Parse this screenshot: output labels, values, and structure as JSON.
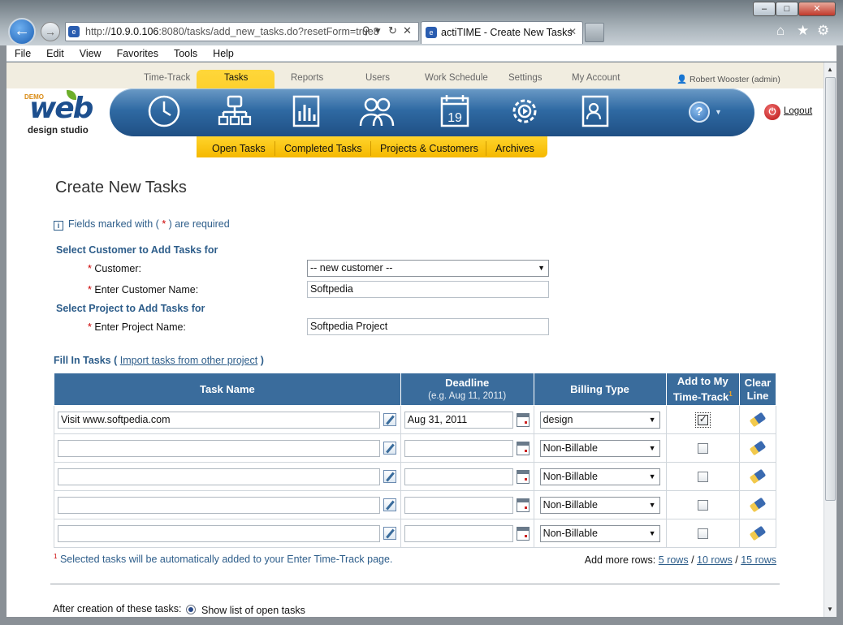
{
  "browser": {
    "url_prefix": "http://",
    "url_host": "10.9.0.106",
    "url_rest": ":8080/tasks/add_new_tasks.do?resetForm=true8",
    "tab_title": "actiTIME - Create New Tasks",
    "menu": [
      "File",
      "Edit",
      "View",
      "Favorites",
      "Tools",
      "Help"
    ],
    "win_buttons": [
      "–",
      "□",
      "✕"
    ]
  },
  "app": {
    "top_links": [
      "Time-Track",
      "Tasks",
      "Reports",
      "Users",
      "Work Schedule",
      "Settings",
      "My Account"
    ],
    "user": "Robert Wooster (admin)",
    "logo_demo": "DEMO",
    "logo_web": "web",
    "logo_sub": "design studio",
    "sub_nav": [
      "Open Tasks",
      "Completed Tasks",
      "Projects & Customers",
      "Archives"
    ],
    "logout": "Logout",
    "help": "?"
  },
  "page": {
    "title": "Create New Tasks",
    "required_note_a": "Fields marked with ( ",
    "required_star": "*",
    "required_note_b": " ) are required",
    "section_customer": "Select Customer to Add Tasks for",
    "customer_label": "Customer:",
    "customer_value": "-- new customer --",
    "customer_name_label": "Enter Customer Name:",
    "customer_name_value": "Softpedia",
    "section_project": "Select Project to Add Tasks for",
    "project_label": "Enter Project Name:",
    "project_value": "Softpedia Project",
    "fill_title": "Fill In Tasks",
    "import_link": "Import tasks from other project",
    "footnote": "Selected tasks will be automatically added to your Enter Time-Track page.",
    "footnote_mark": "1",
    "add_more": "Add more rows:",
    "rows_links": [
      "5 rows",
      "10 rows",
      "15 rows"
    ],
    "after_creation": "After creation of these tasks:",
    "show_list": "Show list of open tasks"
  },
  "table": {
    "headers": {
      "task": "Task Name",
      "deadline": "Deadline",
      "deadline_hint": "(e.g. Aug 11, 2011)",
      "billing": "Billing Type",
      "addtt": "Add to My Time-Track",
      "addtt_mark": "1",
      "clear": "Clear Line"
    },
    "rows": [
      {
        "task": "Visit www.softpedia.com",
        "deadline": "Aug 31, 2011",
        "billing": "design",
        "checked": true
      },
      {
        "task": "",
        "deadline": "",
        "billing": "Non-Billable",
        "checked": false
      },
      {
        "task": "",
        "deadline": "",
        "billing": "Non-Billable",
        "checked": false
      },
      {
        "task": "",
        "deadline": "",
        "billing": "Non-Billable",
        "checked": false
      },
      {
        "task": "",
        "deadline": "",
        "billing": "Non-Billable",
        "checked": false
      }
    ]
  },
  "colors": {
    "accent": "#2d5d8a",
    "header_bg": "#3a6c9c",
    "tab_yellow": "#f5b800"
  }
}
